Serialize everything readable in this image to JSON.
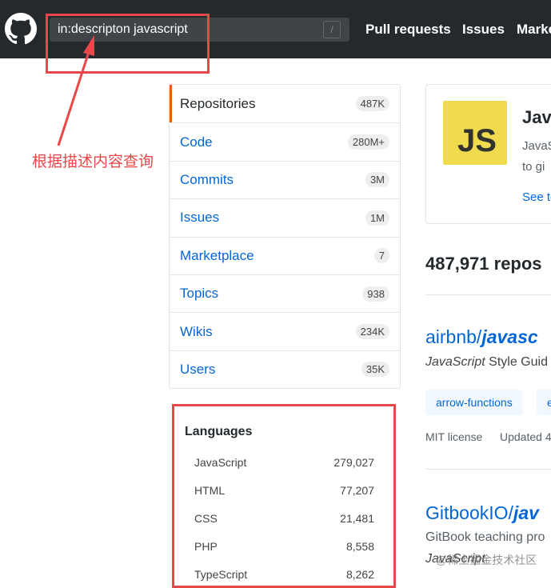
{
  "header": {
    "search_value": "in:descripton javascript",
    "slash_hint": "/",
    "nav": [
      "Pull requests",
      "Issues",
      "Marke"
    ]
  },
  "menu": [
    {
      "label": "Repositories",
      "count": "487K"
    },
    {
      "label": "Code",
      "count": "280M+"
    },
    {
      "label": "Commits",
      "count": "3M"
    },
    {
      "label": "Issues",
      "count": "1M"
    },
    {
      "label": "Marketplace",
      "count": "7"
    },
    {
      "label": "Topics",
      "count": "938"
    },
    {
      "label": "Wikis",
      "count": "234K"
    },
    {
      "label": "Users",
      "count": "35K"
    }
  ],
  "languages": {
    "title": "Languages",
    "items": [
      {
        "name": "JavaScript",
        "count": "279,027"
      },
      {
        "name": "HTML",
        "count": "77,207"
      },
      {
        "name": "CSS",
        "count": "21,481"
      },
      {
        "name": "PHP",
        "count": "8,558"
      },
      {
        "name": "TypeScript",
        "count": "8,262"
      }
    ]
  },
  "topic_card": {
    "logo": "JS",
    "title": "Jav",
    "desc1": "JavaS",
    "desc2": "to gi",
    "link": "See to"
  },
  "results": {
    "count": "487,971 repos",
    "r1": {
      "owner": "airbnb/",
      "name": "javasc",
      "desc_em": "JavaScript",
      "desc": " Style Guid",
      "tags": [
        "arrow-functions",
        "e"
      ],
      "license": "MIT license",
      "updated": "Updated 4"
    },
    "r2": {
      "owner": "GitbookIO/",
      "name": "jav",
      "desc": "GitBook teaching pro",
      "lang": "JavaScript"
    }
  },
  "annotation": {
    "label": "根据描述内容查询"
  },
  "watermark": "@稀土掘金技术社区"
}
